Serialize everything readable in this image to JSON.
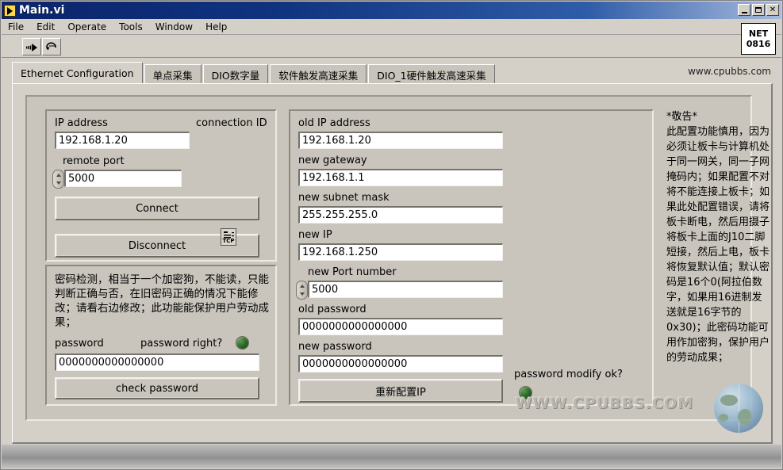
{
  "window": {
    "title": "Main.vi",
    "icon": "labview-vi-icon",
    "buttons": {
      "minimize": "_",
      "maximize": "□",
      "close": "✕"
    }
  },
  "menu": {
    "items": [
      {
        "label": "File"
      },
      {
        "label": "Edit"
      },
      {
        "label": "Operate"
      },
      {
        "label": "Tools"
      },
      {
        "label": "Window"
      },
      {
        "label": "Help"
      }
    ]
  },
  "toolbar": {
    "run_icon": "run-arrow-icon",
    "run_continuous_icon": "run-continuously-icon"
  },
  "net_badge": {
    "line1": "NET",
    "line2": "0816"
  },
  "tabs": {
    "items": [
      {
        "label": "Ethernet Configuration",
        "active": true
      },
      {
        "label": "单点采集",
        "active": false
      },
      {
        "label": "DIO数字量",
        "active": false
      },
      {
        "label": "软件触发高速采集",
        "active": false
      },
      {
        "label": "DIO_1硬件触发高速采集",
        "active": false
      }
    ],
    "url": "www.cpubbs.com"
  },
  "connection": {
    "ip_label": "IP address",
    "ip_value": "192.168.1.20",
    "connection_id_label": "connection ID",
    "connection_id_icon": "tcp-refnum-icon",
    "connection_id_icon_text": "TCP",
    "port_label": "remote port",
    "port_value": "5000",
    "connect_button": "Connect",
    "disconnect_button": "Disconnect"
  },
  "password_panel": {
    "note": "密码检测，相当于一个加密狗，不能读，只能判断正确与否，在旧密码正确的情况下能修改；请看右边修改；此功能能保护用户劳动成果；",
    "password_label": "password",
    "password_right_label": "password right?",
    "password_value": "0000000000000000",
    "check_button": "check password",
    "led_state": "off"
  },
  "config_panel": {
    "old_ip_label": "old IP address",
    "old_ip_value": "192.168.1.20",
    "gateway_label": "new gateway",
    "gateway_value": "192.168.1.1",
    "subnet_label": "new subnet mask",
    "subnet_value": "255.255.255.0",
    "new_ip_label": "new IP",
    "new_ip_value": "192.168.1.250",
    "port_label": "new Port number",
    "port_value": "5000",
    "old_password_label": "old password",
    "old_password_value": "0000000000000000",
    "new_password_label": "new password",
    "new_password_value": "0000000000000000",
    "reconfigure_button": "重新配置IP",
    "modify_ok_label": "password modify ok?",
    "modify_ok_led_state": "off"
  },
  "warning": {
    "title": "*敬告*",
    "body": "此配置功能慎用，因为必须让板卡与计算机处于同一网关，同一子网掩码内；如果配置不对将不能连接上板卡；如果此处配置错误，请将板卡断电，然后用摄子将板卡上面的J10二脚短接，然后上电，板卡将恢复默认值；默认密码是16个0(阿拉伯数字，如果用16进制发送就是16字节的0x30)；此密码功能可用作加密狗，保护用户的劳动成果；"
  },
  "watermark": {
    "text": "WWW.CPUBBS.COM",
    "globe_icon": "globe-icon"
  },
  "colors": {
    "title_bar": "#0a246a",
    "panel_face": "#c9c5bd",
    "window_face": "#d4d0c8",
    "field_bg": "#ffffff",
    "led_green": "#2f6b28"
  }
}
